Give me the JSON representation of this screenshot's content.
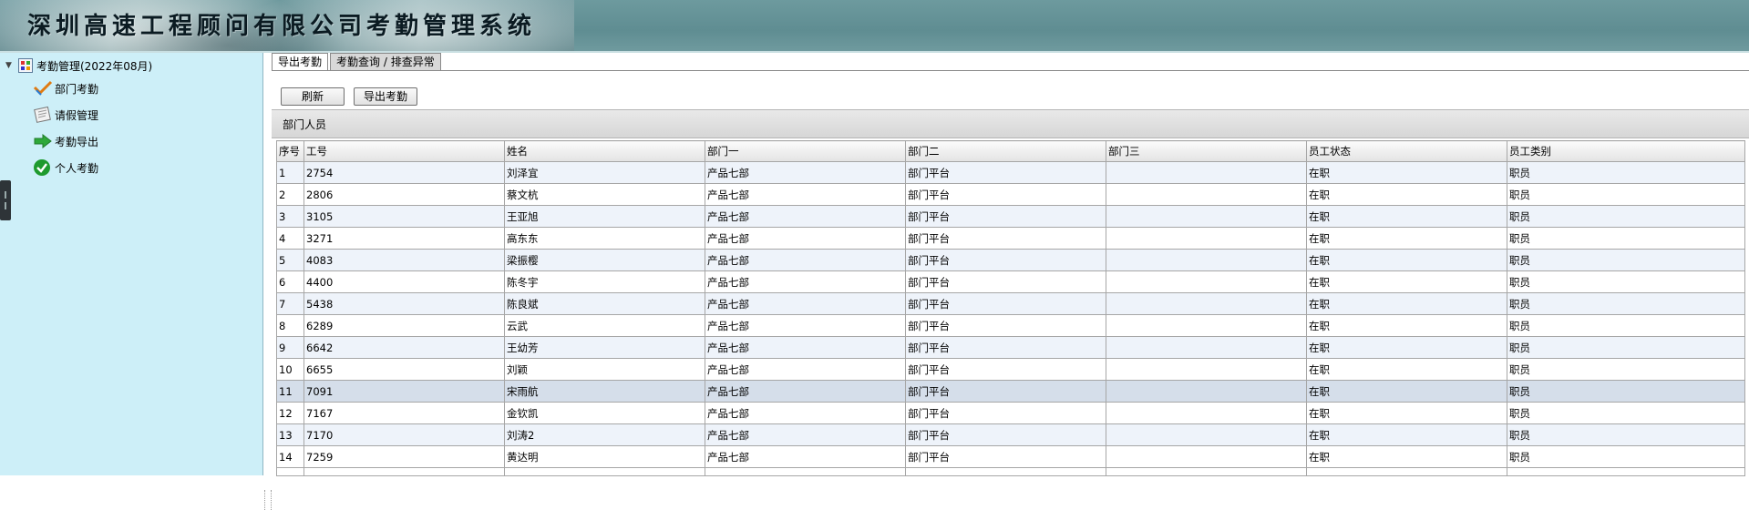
{
  "app": {
    "title": "深圳高速工程顾问有限公司考勤管理系统"
  },
  "sidebar": {
    "root_label": "考勤管理(2022年08月)",
    "items": [
      {
        "label": "部门考勤",
        "icon": "department-attendance-icon"
      },
      {
        "label": "请假管理",
        "icon": "leave-management-icon"
      },
      {
        "label": "考勤导出",
        "icon": "export-arrow-icon"
      },
      {
        "label": "个人考勤",
        "icon": "check-icon"
      }
    ]
  },
  "tabs": [
    {
      "label": "导出考勤",
      "active": true
    },
    {
      "label": "考勤查询 / 排查异常",
      "active": false
    }
  ],
  "toolbar": {
    "refresh_label": "刷新",
    "export_label": "导出考勤"
  },
  "section": {
    "title": "部门人员"
  },
  "table": {
    "columns": [
      "序号",
      "工号",
      "姓名",
      "部门一",
      "部门二",
      "部门三",
      "员工状态",
      "员工类别"
    ],
    "rows": [
      [
        "1",
        "2754",
        "刘泽宜",
        "产品七部",
        "部门平台",
        "",
        "在职",
        "职员"
      ],
      [
        "2",
        "2806",
        "蔡文杭",
        "产品七部",
        "部门平台",
        "",
        "在职",
        "职员"
      ],
      [
        "3",
        "3105",
        "王亚旭",
        "产品七部",
        "部门平台",
        "",
        "在职",
        "职员"
      ],
      [
        "4",
        "3271",
        "高东东",
        "产品七部",
        "部门平台",
        "",
        "在职",
        "职员"
      ],
      [
        "5",
        "4083",
        "梁振樱",
        "产品七部",
        "部门平台",
        "",
        "在职",
        "职员"
      ],
      [
        "6",
        "4400",
        "陈冬宇",
        "产品七部",
        "部门平台",
        "",
        "在职",
        "职员"
      ],
      [
        "7",
        "5438",
        "陈良斌",
        "产品七部",
        "部门平台",
        "",
        "在职",
        "职员"
      ],
      [
        "8",
        "6289",
        "云武",
        "产品七部",
        "部门平台",
        "",
        "在职",
        "职员"
      ],
      [
        "9",
        "6642",
        "王幼芳",
        "产品七部",
        "部门平台",
        "",
        "在职",
        "职员"
      ],
      [
        "10",
        "6655",
        "刘颖",
        "产品七部",
        "部门平台",
        "",
        "在职",
        "职员"
      ],
      [
        "11",
        "7091",
        "宋雨航",
        "产品七部",
        "部门平台",
        "",
        "在职",
        "职员"
      ],
      [
        "12",
        "7167",
        "金钦凯",
        "产品七部",
        "部门平台",
        "",
        "在职",
        "职员"
      ],
      [
        "13",
        "7170",
        "刘涛2",
        "产品七部",
        "部门平台",
        "",
        "在职",
        "职员"
      ],
      [
        "14",
        "7259",
        "黄达明",
        "产品七部",
        "部门平台",
        "",
        "在职",
        "职员"
      ]
    ],
    "selected_row": 11
  },
  "colors": {
    "sidebar_bg": "#cdeff8",
    "row_alt": "#eef3fa",
    "row_selected": "#d5deea"
  }
}
